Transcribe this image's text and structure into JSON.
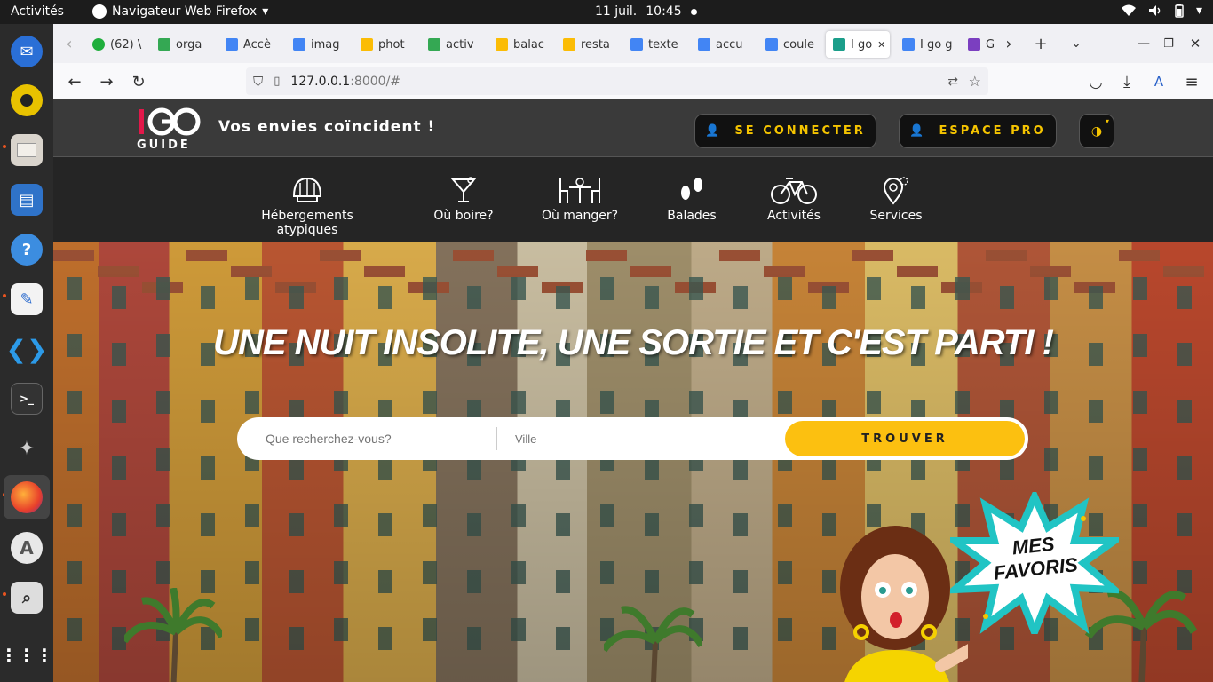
{
  "system": {
    "activities": "Activités",
    "app_name": "Navigateur Web Firefox",
    "date": "11 juil.",
    "time": "10:45"
  },
  "browser": {
    "tabs": [
      {
        "label": "(62) \\",
        "favicon_color": "#1fae3c",
        "badge": "62"
      },
      {
        "label": "orga",
        "favicon_color": "#34a853"
      },
      {
        "label": "Accè",
        "favicon_color": "#4285f4"
      },
      {
        "label": "imag",
        "favicon_color": "#4285f4"
      },
      {
        "label": "phot",
        "favicon_color": "#fbbc05"
      },
      {
        "label": "activ",
        "favicon_color": "#34a853"
      },
      {
        "label": "balac",
        "favicon_color": "#fbbc05"
      },
      {
        "label": "resta",
        "favicon_color": "#fbbc05"
      },
      {
        "label": "texte",
        "favicon_color": "#4285f4"
      },
      {
        "label": "accu",
        "favicon_color": "#4285f4"
      },
      {
        "label": "coule",
        "favicon_color": "#4285f4"
      },
      {
        "label": "I go",
        "favicon_color": "#1b9e8a",
        "active": true
      },
      {
        "label": "I go g",
        "favicon_color": "#4285f4"
      },
      {
        "label": "G",
        "favicon_color": "#7b3fc0"
      }
    ],
    "url_host": "127.0.0.1",
    "url_rest": ":8000/#"
  },
  "site": {
    "logo_text_top": "IGO",
    "logo_text_bottom": "GUIDE",
    "tagline": "Vos envies coïncident !",
    "login_label": "SE CONNECTER",
    "pro_label": "ESPACE PRO",
    "categories": [
      {
        "label": "Hébergements atypiques",
        "icon": "tent-icon"
      },
      {
        "label": "Où boire?",
        "icon": "cocktail-icon"
      },
      {
        "label": "Où manger?",
        "icon": "table-icon"
      },
      {
        "label": "Balades",
        "icon": "footprints-icon"
      },
      {
        "label": "Activités",
        "icon": "bicycle-icon"
      },
      {
        "label": "Services",
        "icon": "gear-pin-icon"
      }
    ],
    "hero_title": "UNE NUIT INSOLITE, UNE SORTIE ET C'EST PARTI !",
    "search_placeholder": "Que recherchez-vous?",
    "city_placeholder": "Ville",
    "find_label": "TROUVER",
    "favorites_line1": "MES",
    "favorites_line2": "FAVORIS",
    "accent_color": "#fcc010"
  }
}
